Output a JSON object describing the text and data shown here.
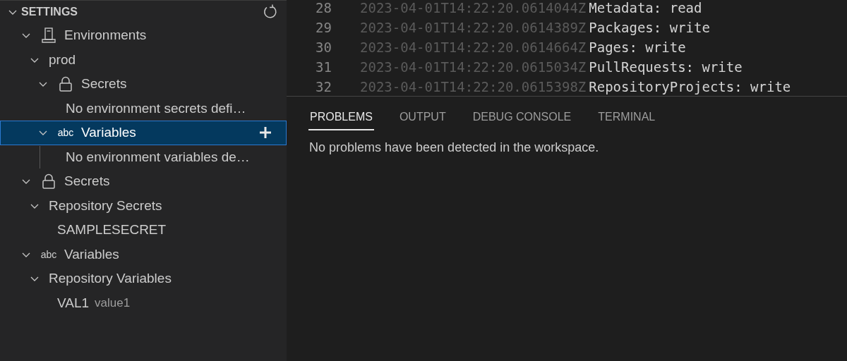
{
  "sidebar": {
    "section": {
      "title": "SETTINGS",
      "expanded": true
    },
    "tree": [
      {
        "label": "Environments",
        "kind": "environments",
        "expanded": true,
        "selected": false,
        "children": [
          {
            "label": "prod",
            "expanded": true,
            "selected": false,
            "children": [
              {
                "label": "Secrets",
                "kind": "secrets",
                "expanded": true,
                "selected": false,
                "children": [
                  {
                    "label": "No environment secrets defi…",
                    "selected": false
                  }
                ]
              },
              {
                "label": "Variables",
                "kind": "variables",
                "icon_text": "abc",
                "expanded": true,
                "selected": true,
                "children": [
                  {
                    "label": "No environment variables de…",
                    "selected": false
                  }
                ]
              }
            ]
          }
        ]
      },
      {
        "label": "Secrets",
        "kind": "secrets",
        "expanded": true,
        "selected": false,
        "children": [
          {
            "label": "Repository Secrets",
            "expanded": true,
            "selected": false,
            "children": [
              {
                "label": "SAMPLESECRET",
                "selected": false
              }
            ]
          }
        ]
      },
      {
        "label": "Variables",
        "kind": "variables",
        "icon_text": "abc",
        "expanded": true,
        "selected": false,
        "children": [
          {
            "label": "Repository Variables",
            "expanded": true,
            "selected": false,
            "children": [
              {
                "label": "VAL1",
                "description": "value1",
                "selected": false
              }
            ]
          }
        ]
      }
    ]
  },
  "editor": {
    "lines": [
      {
        "number": "28",
        "time": "2023-04-01T14:22:20.0614044Z",
        "text": "Metadata: read"
      },
      {
        "number": "29",
        "time": "2023-04-01T14:22:20.0614389Z",
        "text": "Packages: write"
      },
      {
        "number": "30",
        "time": "2023-04-01T14:22:20.0614664Z",
        "text": "Pages: write"
      },
      {
        "number": "31",
        "time": "2023-04-01T14:22:20.0615034Z",
        "text": "PullRequests: write"
      },
      {
        "number": "32",
        "time": "2023-04-01T14:22:20.0615398Z",
        "text": "RepositoryProjects: write"
      }
    ]
  },
  "panel": {
    "tabs": [
      {
        "label": "PROBLEMS",
        "selected": true
      },
      {
        "label": "OUTPUT",
        "selected": false
      },
      {
        "label": "DEBUG CONSOLE",
        "selected": false
      },
      {
        "label": "TERMINAL",
        "selected": false
      }
    ],
    "message": "No problems have been detected in the workspace."
  }
}
